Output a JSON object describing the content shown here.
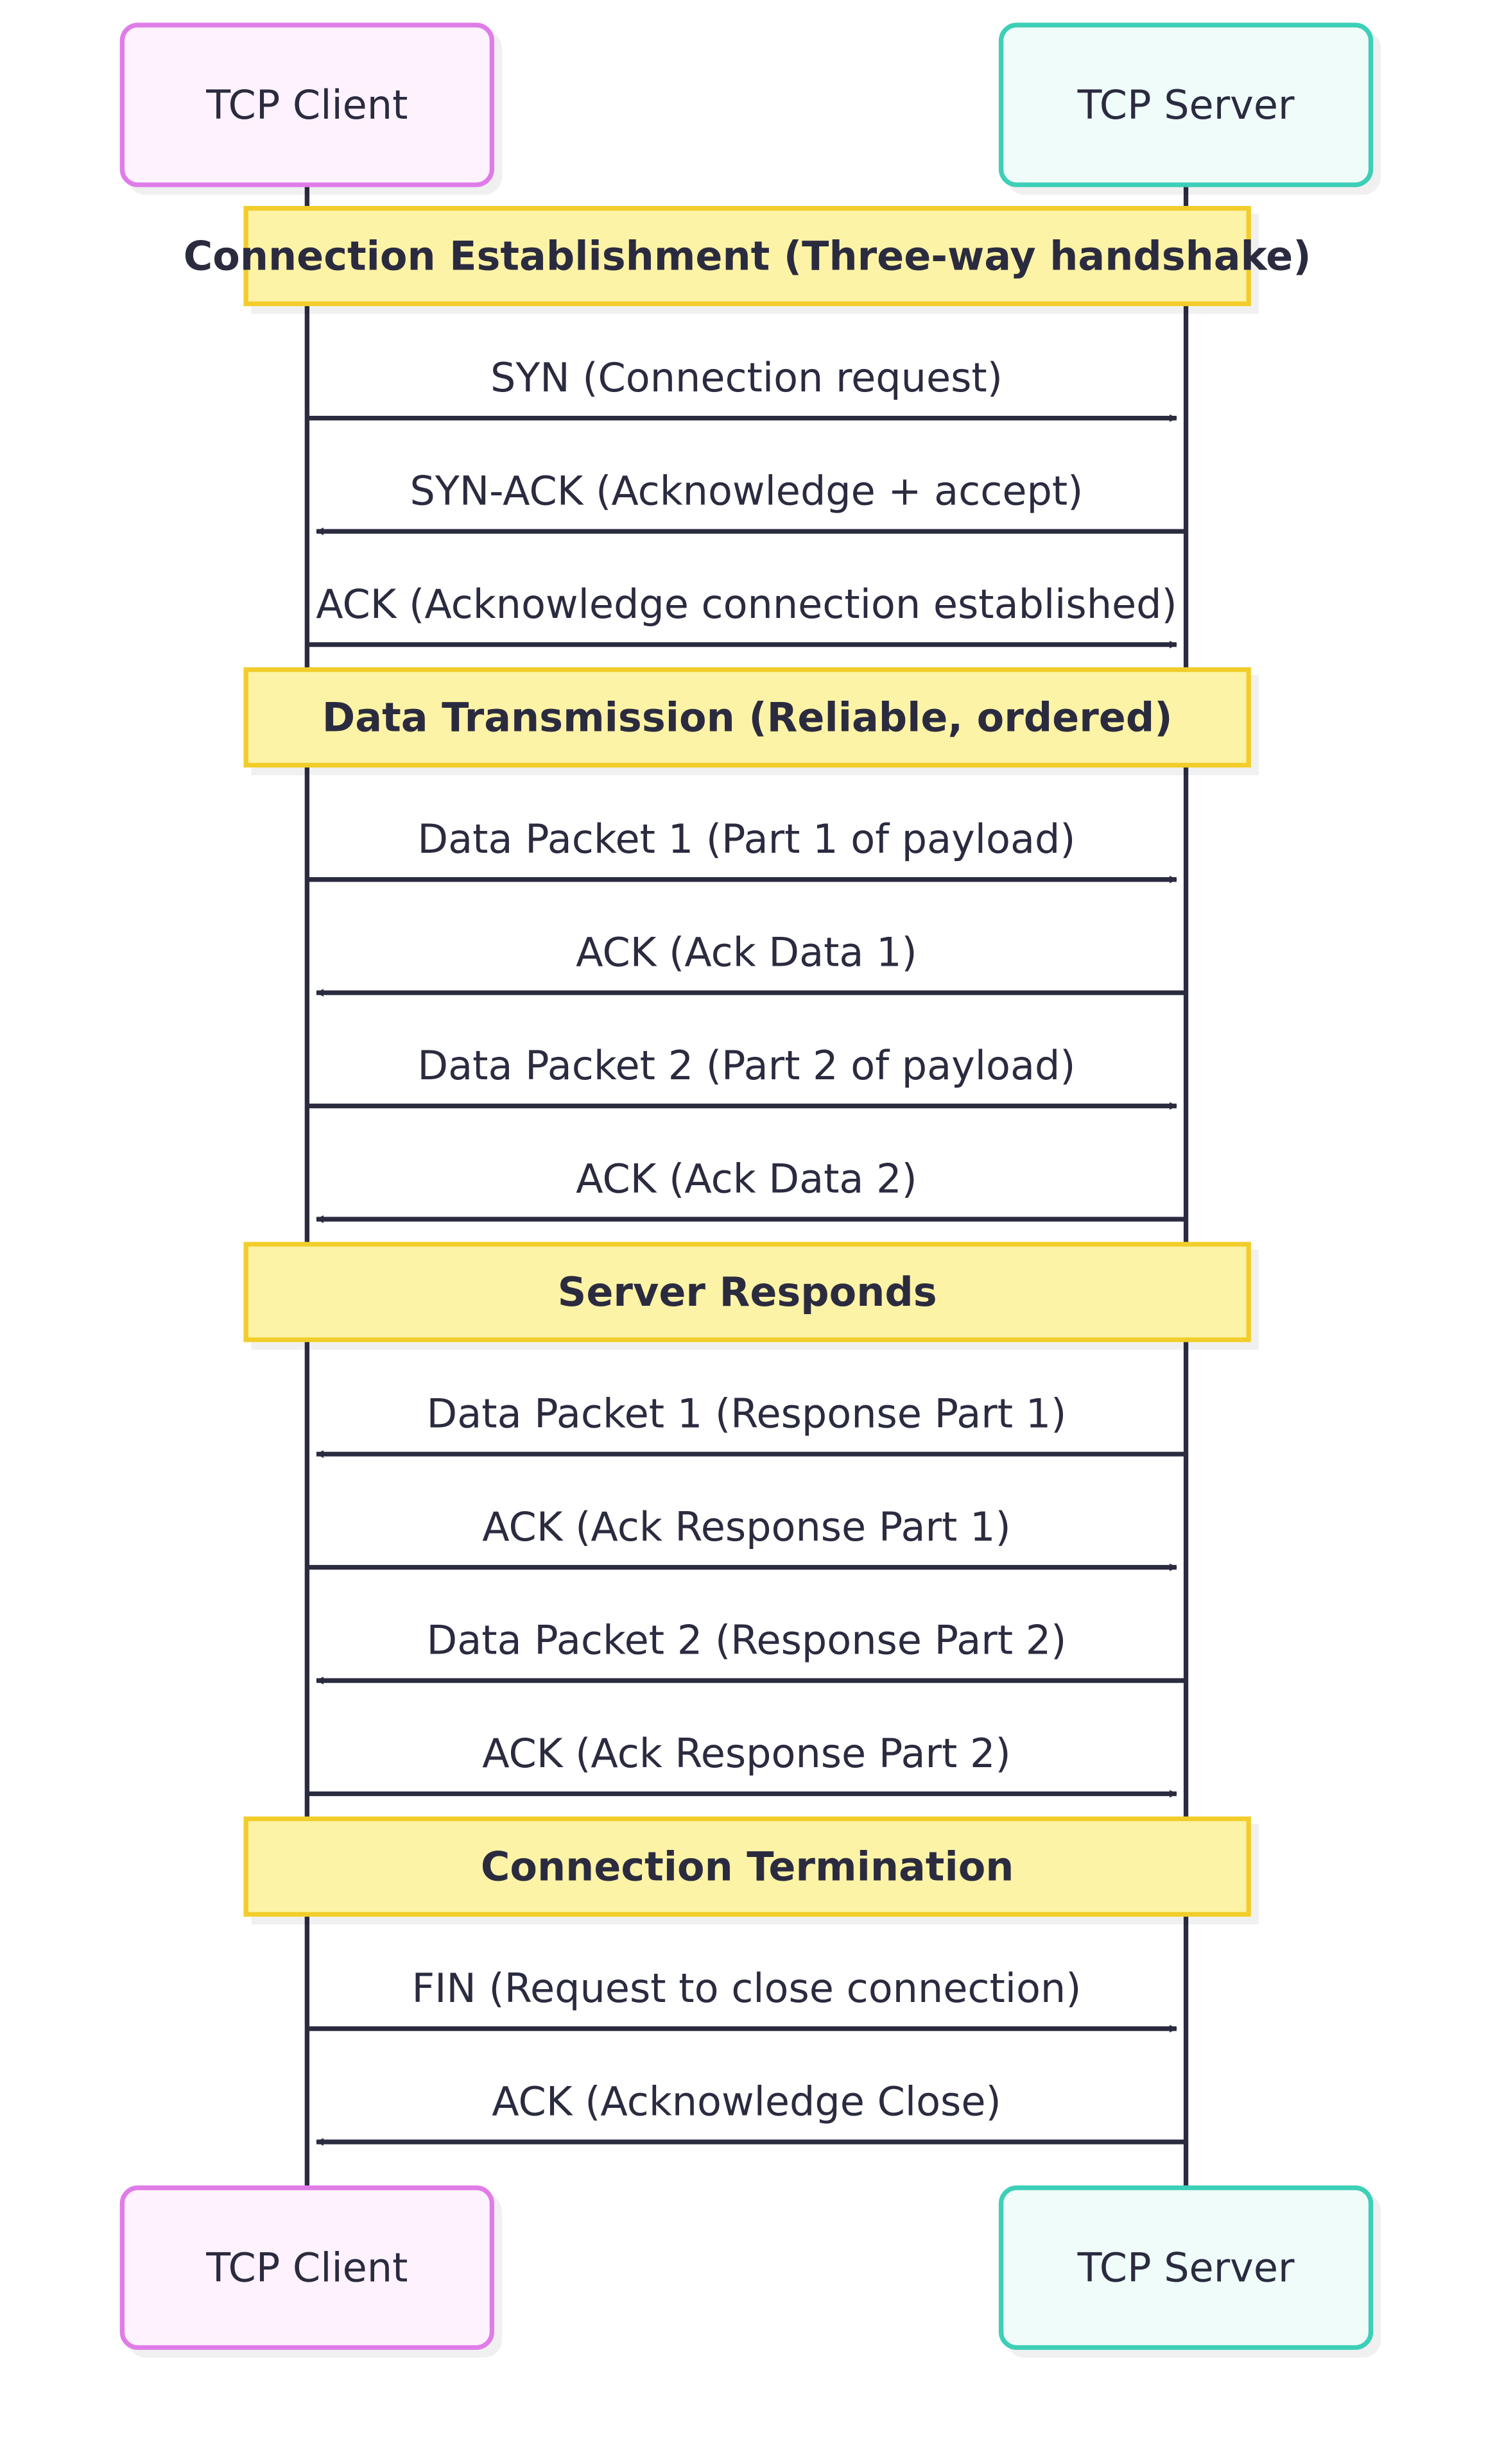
{
  "participants": [
    {
      "id": "client",
      "name": "TCP Client",
      "fill": "#fdf2fd",
      "stroke": "#e07be8"
    },
    {
      "id": "server",
      "name": "TCP Server",
      "fill": "#effcf9",
      "stroke": "#3ccfb7"
    }
  ],
  "colors": {
    "line": "#2b2b40",
    "note_fill": "#fdf3a6",
    "note_stroke": "#f2cd2c"
  },
  "sections": [
    {
      "note": "Connection Establishment (Three-way handshake)",
      "messages": [
        {
          "from": "client",
          "to": "server",
          "text": "SYN (Connection request)"
        },
        {
          "from": "server",
          "to": "client",
          "text": "SYN-ACK (Acknowledge + accept)"
        },
        {
          "from": "client",
          "to": "server",
          "text": "ACK (Acknowledge connection established)"
        }
      ]
    },
    {
      "note": "Data Transmission (Reliable, ordered)",
      "messages": [
        {
          "from": "client",
          "to": "server",
          "text": "Data Packet 1 (Part 1 of payload)"
        },
        {
          "from": "server",
          "to": "client",
          "text": "ACK (Ack Data 1)"
        },
        {
          "from": "client",
          "to": "server",
          "text": "Data Packet 2 (Part 2 of payload)"
        },
        {
          "from": "server",
          "to": "client",
          "text": "ACK (Ack Data 2)"
        }
      ]
    },
    {
      "note": "Server Responds",
      "messages": [
        {
          "from": "server",
          "to": "client",
          "text": "Data Packet 1 (Response Part 1)"
        },
        {
          "from": "client",
          "to": "server",
          "text": "ACK (Ack Response Part 1)"
        },
        {
          "from": "server",
          "to": "client",
          "text": "Data Packet 2 (Response Part 2)"
        },
        {
          "from": "client",
          "to": "server",
          "text": "ACK (Ack Response Part 2)"
        }
      ]
    },
    {
      "note": "Connection Termination",
      "messages": [
        {
          "from": "client",
          "to": "server",
          "text": "FIN (Request to close connection)"
        },
        {
          "from": "server",
          "to": "client",
          "text": "ACK (Acknowledge Close)"
        }
      ]
    }
  ]
}
